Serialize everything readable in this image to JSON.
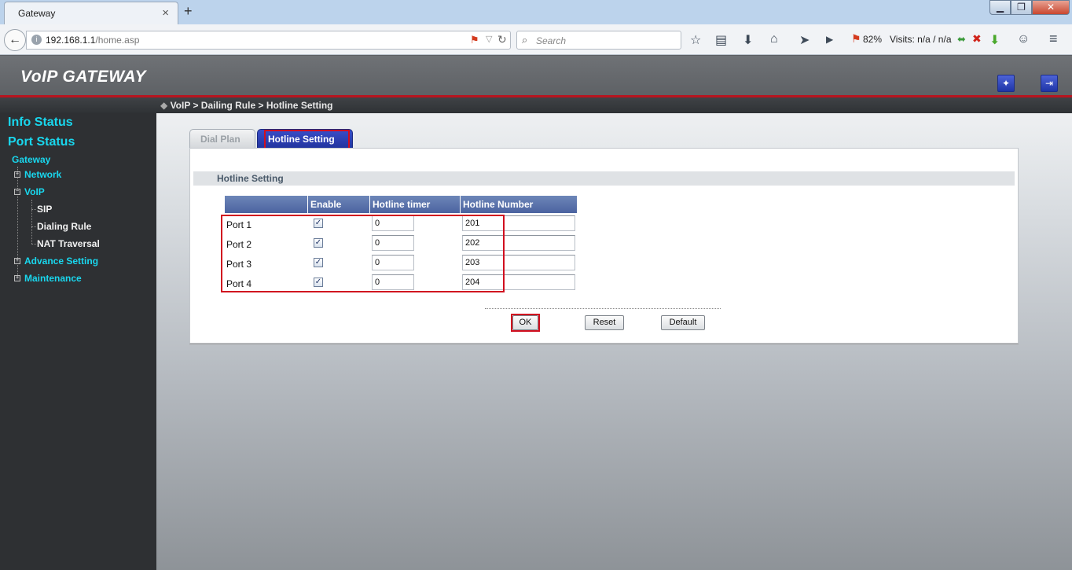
{
  "browser": {
    "tab_title": "Gateway",
    "url_host": "192.168.1.1",
    "url_path": "/home.asp",
    "search_placeholder": "Search",
    "percent": "82%",
    "visits": "Visits: n/a / n/a"
  },
  "app": {
    "title": "VoIP GATEWAY",
    "breadcrumb": "VoIP > Dailing Rule > Hotline Setting"
  },
  "sidebar": {
    "info_status": "Info Status",
    "port_status": "Port Status",
    "gateway": "Gateway",
    "network": "Network",
    "voip": "VoIP",
    "sip": "SIP",
    "dialing_rule": "Dialing Rule",
    "nat_traversal": "NAT Traversal",
    "advance_setting": "Advance Setting",
    "maintenance": "Maintenance"
  },
  "tabs": {
    "dial_plan": "Dial Plan",
    "hotline_setting": "Hotline Setting"
  },
  "section": {
    "title": "Hotline Setting"
  },
  "table": {
    "headers": [
      "",
      "Enable",
      "Hotline timer",
      "Hotline Number"
    ],
    "rows": [
      {
        "port": "Port 1",
        "enabled": true,
        "timer": "0",
        "number": "201"
      },
      {
        "port": "Port 2",
        "enabled": true,
        "timer": "0",
        "number": "202"
      },
      {
        "port": "Port 3",
        "enabled": true,
        "timer": "0",
        "number": "203"
      },
      {
        "port": "Port 4",
        "enabled": true,
        "timer": "0",
        "number": "204"
      }
    ]
  },
  "buttons": {
    "ok": "OK",
    "reset": "Reset",
    "default": "Default"
  },
  "colors": {
    "accent_cyan": "#19d7ee",
    "highlight_red": "#d10f1f",
    "tab_active": "#22349f"
  }
}
